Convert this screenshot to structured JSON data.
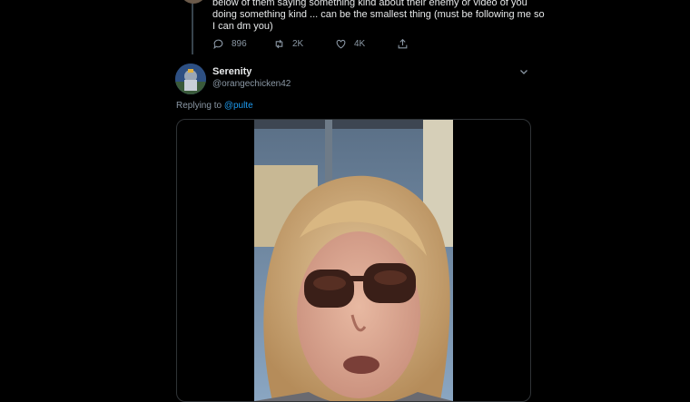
{
  "tweet": {
    "lines": [
      "below of them saying something kind about their enemy or video of you",
      "doing something kind ... can be the smallest thing (must be following me so",
      "I can dm you)"
    ],
    "actions": {
      "replies": "896",
      "retweets": "2K",
      "likes": "4K"
    }
  },
  "reply": {
    "name": "Serenity",
    "handle": "@orangechicken42",
    "replying_prefix": "Replying to",
    "replying_to": "@pulte"
  },
  "icons": [
    "reply-icon",
    "retweet-icon",
    "like-icon",
    "share-icon",
    "chevron-down-icon"
  ],
  "colors": {
    "background": "#000000",
    "accent": "#1d9bf0",
    "muted": "#8b98a5"
  }
}
